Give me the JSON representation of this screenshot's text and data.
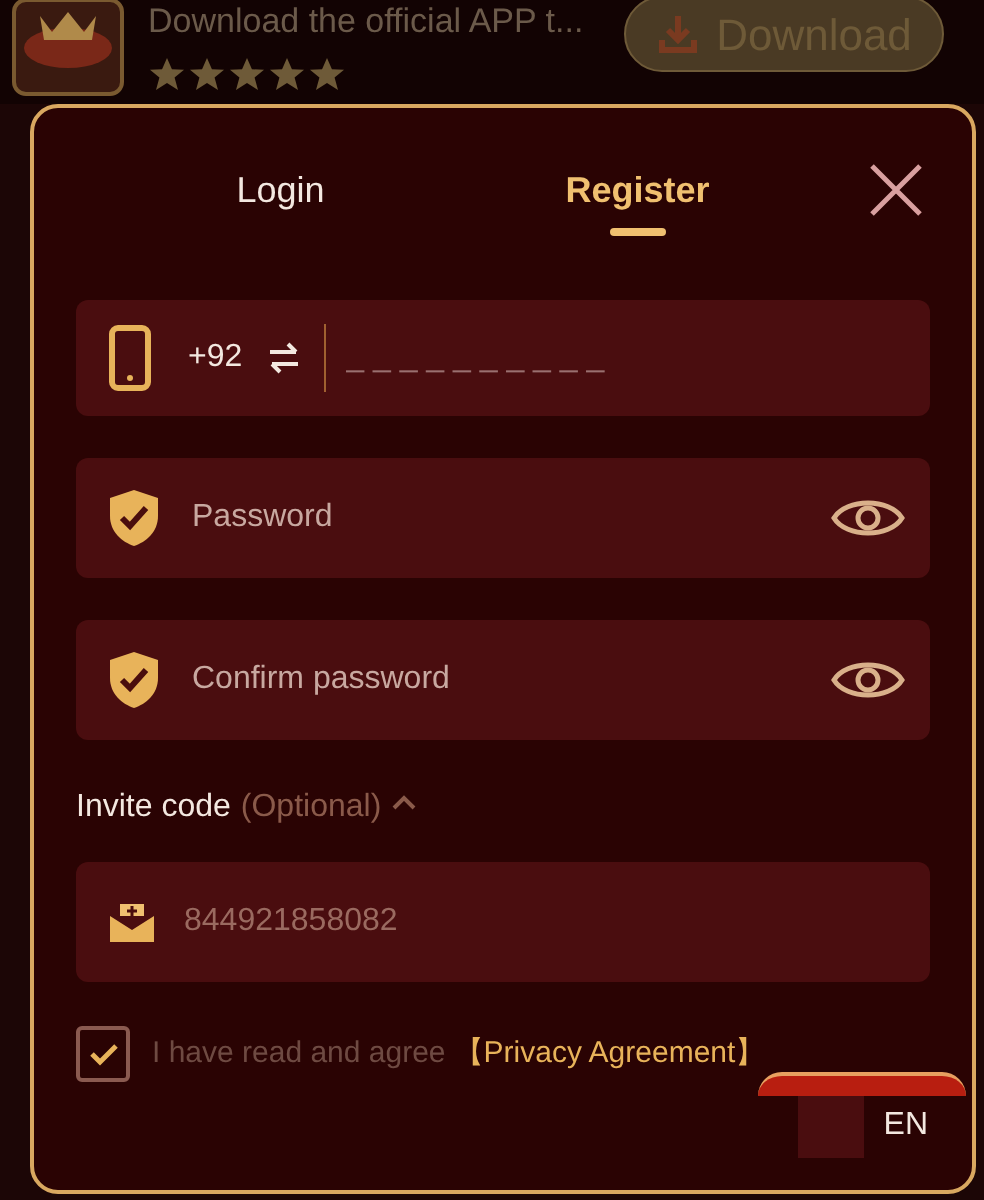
{
  "banner": {
    "text": "Download the official APP t...",
    "stars": 5,
    "download_button": "Download"
  },
  "tabs": [
    {
      "label": "Login",
      "selected": false
    },
    {
      "label": "Register",
      "selected": true
    }
  ],
  "phone_field": {
    "country_code": "+92",
    "placeholder": "_ _ _ _ _ _ _ _ _ _"
  },
  "password_fields": [
    {
      "placeholder": "Password"
    },
    {
      "placeholder": "Confirm password"
    }
  ],
  "invite": {
    "label": "Invite code",
    "hint": "(Optional)",
    "expanded": true,
    "value": "844921858082"
  },
  "agreement": {
    "checked": true,
    "text": "I have read and agree",
    "link": "【Privacy Agreement】"
  },
  "language": "EN"
}
